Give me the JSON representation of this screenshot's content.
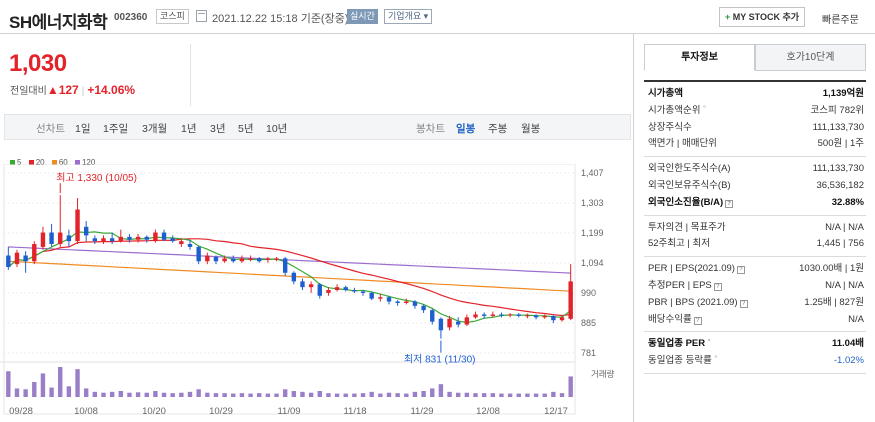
{
  "header": {
    "company_name": "SH에너지화학",
    "stock_code": "002360",
    "market": "코스피",
    "datetime": "2021.12.22 15:18 기준(장중)",
    "realtime_badge": "실시간",
    "company_info": "기업개요",
    "my_stock_button": "MY STOCK 추가",
    "my_stock_plus": "+",
    "quick_order": "빠른주문"
  },
  "price": {
    "current": "1,030",
    "change_label": "전일대비",
    "change_arrow": "▲",
    "change": "127",
    "change_pct": "+14.06%"
  },
  "period_bar": {
    "line_label": "선차트",
    "periods": [
      "1일",
      "1주일",
      "3개월",
      "1년",
      "3년",
      "5년",
      "10년"
    ],
    "candle_label": "봉차트",
    "candle_periods": [
      "일봉",
      "주봉",
      "월봉"
    ],
    "active_candle": "일봉"
  },
  "legend": [
    {
      "label": "5",
      "color": "#3aaa35"
    },
    {
      "label": "20",
      "color": "#e4222a"
    },
    {
      "label": "60",
      "color": "#f08a24"
    },
    {
      "label": "120",
      "color": "#9b6fd0"
    }
  ],
  "chart_data": {
    "type": "candlestick",
    "y_ticks": [
      "1,407",
      "1,303",
      "1,199",
      "1,094",
      "990",
      "885",
      "781"
    ],
    "x_ticks": [
      "09/28",
      "10/08",
      "10/20",
      "10/29",
      "11/09",
      "11/18",
      "11/29",
      "12/08",
      "12/17"
    ],
    "high_annotation": "최고 1,330 (10/05)",
    "low_annotation": "최저 831 (11/30)",
    "volume_label": "거래량",
    "ylim": [
      781,
      1407
    ],
    "candles": [
      {
        "o": 1120,
        "c": 1080,
        "h": 1150,
        "l": 1070
      },
      {
        "o": 1090,
        "c": 1130,
        "h": 1140,
        "l": 1080
      },
      {
        "o": 1120,
        "c": 1100,
        "h": 1135,
        "l": 1060
      },
      {
        "o": 1100,
        "c": 1160,
        "h": 1170,
        "l": 1090
      },
      {
        "o": 1150,
        "c": 1200,
        "h": 1220,
        "l": 1140
      },
      {
        "o": 1200,
        "c": 1160,
        "h": 1230,
        "l": 1150
      },
      {
        "o": 1160,
        "c": 1200,
        "h": 1330,
        "l": 1150
      },
      {
        "o": 1190,
        "c": 1170,
        "h": 1210,
        "l": 1150
      },
      {
        "o": 1170,
        "c": 1280,
        "h": 1320,
        "l": 1160
      },
      {
        "o": 1220,
        "c": 1190,
        "h": 1240,
        "l": 1170
      },
      {
        "o": 1180,
        "c": 1170,
        "h": 1190,
        "l": 1160
      },
      {
        "o": 1170,
        "c": 1180,
        "h": 1190,
        "l": 1160
      },
      {
        "o": 1180,
        "c": 1170,
        "h": 1200,
        "l": 1160
      },
      {
        "o": 1170,
        "c": 1185,
        "h": 1210,
        "l": 1165
      },
      {
        "o": 1185,
        "c": 1175,
        "h": 1195,
        "l": 1165
      },
      {
        "o": 1175,
        "c": 1185,
        "h": 1195,
        "l": 1165
      },
      {
        "o": 1185,
        "c": 1175,
        "h": 1190,
        "l": 1165
      },
      {
        "o": 1170,
        "c": 1200,
        "h": 1210,
        "l": 1165
      },
      {
        "o": 1200,
        "c": 1175,
        "h": 1210,
        "l": 1170
      },
      {
        "o": 1180,
        "c": 1170,
        "h": 1190,
        "l": 1165
      },
      {
        "o": 1160,
        "c": 1170,
        "h": 1180,
        "l": 1150
      },
      {
        "o": 1160,
        "c": 1150,
        "h": 1175,
        "l": 1140
      },
      {
        "o": 1150,
        "c": 1100,
        "h": 1155,
        "l": 1090
      },
      {
        "o": 1100,
        "c": 1120,
        "h": 1130,
        "l": 1090
      },
      {
        "o": 1115,
        "c": 1100,
        "h": 1120,
        "l": 1090
      },
      {
        "o": 1100,
        "c": 1110,
        "h": 1120,
        "l": 1095
      },
      {
        "o": 1110,
        "c": 1100,
        "h": 1120,
        "l": 1095
      },
      {
        "o": 1100,
        "c": 1110,
        "h": 1120,
        "l": 1095
      },
      {
        "o": 1105,
        "c": 1110,
        "h": 1120,
        "l": 1100
      },
      {
        "o": 1110,
        "c": 1100,
        "h": 1115,
        "l": 1095
      },
      {
        "o": 1105,
        "c": 1110,
        "h": 1115,
        "l": 1095
      },
      {
        "o": 1105,
        "c": 1110,
        "h": 1115,
        "l": 1100
      },
      {
        "o": 1110,
        "c": 1060,
        "h": 1115,
        "l": 1050
      },
      {
        "o": 1060,
        "c": 1030,
        "h": 1065,
        "l": 1020
      },
      {
        "o": 1030,
        "c": 1010,
        "h": 1040,
        "l": 1000
      },
      {
        "o": 1010,
        "c": 1020,
        "h": 1030,
        "l": 990
      },
      {
        "o": 1020,
        "c": 980,
        "h": 1025,
        "l": 970
      },
      {
        "o": 990,
        "c": 1000,
        "h": 1010,
        "l": 980
      },
      {
        "o": 1000,
        "c": 1010,
        "h": 1020,
        "l": 995
      },
      {
        "o": 1010,
        "c": 1000,
        "h": 1015,
        "l": 995
      },
      {
        "o": 1000,
        "c": 995,
        "h": 1008,
        "l": 990
      },
      {
        "o": 995,
        "c": 990,
        "h": 1000,
        "l": 980
      },
      {
        "o": 990,
        "c": 970,
        "h": 995,
        "l": 965
      },
      {
        "o": 970,
        "c": 975,
        "h": 985,
        "l": 960
      },
      {
        "o": 975,
        "c": 960,
        "h": 980,
        "l": 950
      },
      {
        "o": 960,
        "c": 955,
        "h": 965,
        "l": 945
      },
      {
        "o": 955,
        "c": 960,
        "h": 970,
        "l": 950
      },
      {
        "o": 960,
        "c": 945,
        "h": 965,
        "l": 935
      },
      {
        "o": 945,
        "c": 930,
        "h": 950,
        "l": 920
      },
      {
        "o": 930,
        "c": 890,
        "h": 935,
        "l": 880
      },
      {
        "o": 900,
        "c": 860,
        "h": 905,
        "l": 831
      },
      {
        "o": 870,
        "c": 900,
        "h": 910,
        "l": 860
      },
      {
        "o": 890,
        "c": 880,
        "h": 905,
        "l": 870
      },
      {
        "o": 880,
        "c": 905,
        "h": 915,
        "l": 875
      },
      {
        "o": 905,
        "c": 915,
        "h": 925,
        "l": 900
      },
      {
        "o": 915,
        "c": 910,
        "h": 922,
        "l": 900
      },
      {
        "o": 910,
        "c": 915,
        "h": 925,
        "l": 905
      },
      {
        "o": 915,
        "c": 912,
        "h": 922,
        "l": 905
      },
      {
        "o": 912,
        "c": 915,
        "h": 920,
        "l": 905
      },
      {
        "o": 915,
        "c": 910,
        "h": 920,
        "l": 905
      },
      {
        "o": 910,
        "c": 912,
        "h": 918,
        "l": 902
      },
      {
        "o": 912,
        "c": 905,
        "h": 916,
        "l": 898
      },
      {
        "o": 905,
        "c": 910,
        "h": 915,
        "l": 900
      },
      {
        "o": 910,
        "c": 895,
        "h": 912,
        "l": 885
      },
      {
        "o": 895,
        "c": 905,
        "h": 910,
        "l": 890
      },
      {
        "o": 900,
        "c": 1030,
        "h": 1090,
        "l": 895
      }
    ],
    "volume": [
      60,
      20,
      18,
      35,
      55,
      22,
      70,
      25,
      65,
      20,
      12,
      10,
      12,
      14,
      10,
      11,
      10,
      14,
      10,
      9,
      10,
      12,
      18,
      10,
      9,
      9,
      8,
      9,
      8,
      9,
      8,
      8,
      18,
      14,
      12,
      10,
      14,
      9,
      8,
      8,
      8,
      9,
      12,
      8,
      10,
      9,
      8,
      12,
      14,
      20,
      30,
      12,
      10,
      10,
      9,
      9,
      9,
      8,
      8,
      8,
      8,
      8,
      8,
      12,
      9,
      48
    ]
  },
  "panel": {
    "tabs": [
      "투자정보",
      "호가10단계"
    ],
    "groups": [
      [
        {
          "k": "시가총액",
          "v": "1,139억원"
        },
        {
          "k": "시가총액순위",
          "v": "코스피 782위"
        },
        {
          "k": "상장주식수",
          "v": "111,133,730"
        },
        {
          "k": "액면가 | 매매단위",
          "v": "500원 | 1주"
        }
      ],
      [
        {
          "k": "외국인한도주식수(A)",
          "v": "111,133,730"
        },
        {
          "k": "외국인보유주식수(B)",
          "v": "36,536,182"
        },
        {
          "k": "외국인소진율(B/A)",
          "v": "32.88%"
        }
      ],
      [
        {
          "k": "투자의견 | 목표주가",
          "v": "N/A | N/A"
        },
        {
          "k": "52주최고 | 최저",
          "v": "1,445 | 756"
        }
      ],
      [
        {
          "k": "PER | EPS(2021.09)",
          "v": "1030.00배 | 1원"
        },
        {
          "k": "추정PER | EPS",
          "v": "N/A | N/A"
        },
        {
          "k": "PBR | BPS (2021.09)",
          "v": "1.25배 | 827원"
        },
        {
          "k": "배당수익률",
          "v": "N/A"
        }
      ],
      [
        {
          "k": "동일업종 PER",
          "v": "11.04배"
        },
        {
          "k": "동일업종 등락률",
          "v": "-1.02%"
        }
      ]
    ]
  }
}
